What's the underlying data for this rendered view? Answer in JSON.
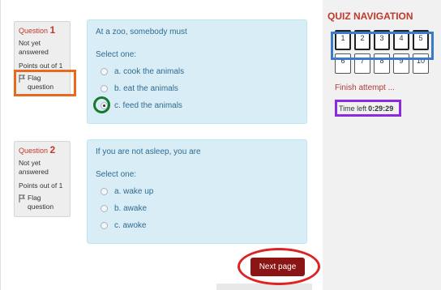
{
  "questions": [
    {
      "label": "Question",
      "number": "1",
      "status": "Not yet answered",
      "grade": "Points out of 1",
      "flag_label": "Flag question",
      "text": "At a zoo, somebody must",
      "prompt": "Select one:",
      "answers": [
        {
          "label": "a. cook the animals",
          "checked": false
        },
        {
          "label": "b. eat the animals",
          "checked": false
        },
        {
          "label": "c. feed the animals",
          "checked": true
        }
      ]
    },
    {
      "label": "Question",
      "number": "2",
      "status": "Not yet answered",
      "grade": "Points out of 1",
      "flag_label": "Flag question",
      "text": "If you are not asleep, you are",
      "prompt": "Select one:",
      "answers": [
        {
          "label": "a. wake up",
          "checked": false
        },
        {
          "label": "b. awake",
          "checked": false
        },
        {
          "label": "c. awoke",
          "checked": false
        }
      ]
    }
  ],
  "next_button": "Next page",
  "navigation": {
    "title": "QUIZ NAVIGATION",
    "row1": [
      "1",
      "2",
      "3",
      "4",
      "5"
    ],
    "row2": [
      "6",
      "7",
      "8",
      "9",
      "10"
    ],
    "finish_label": "Finish attempt ...",
    "timer_label": "Time left",
    "timer_value": "0:29:29"
  },
  "colors": {
    "accent_red": "#c0392b",
    "next_button_bg": "#8b1414",
    "question_bg": "#d9edf7",
    "highlight_orange": "#e86a1f",
    "highlight_green": "#177a2e",
    "highlight_blue": "#3b7ac9",
    "highlight_purple": "#8a2be2",
    "highlight_red": "#dd2222"
  }
}
